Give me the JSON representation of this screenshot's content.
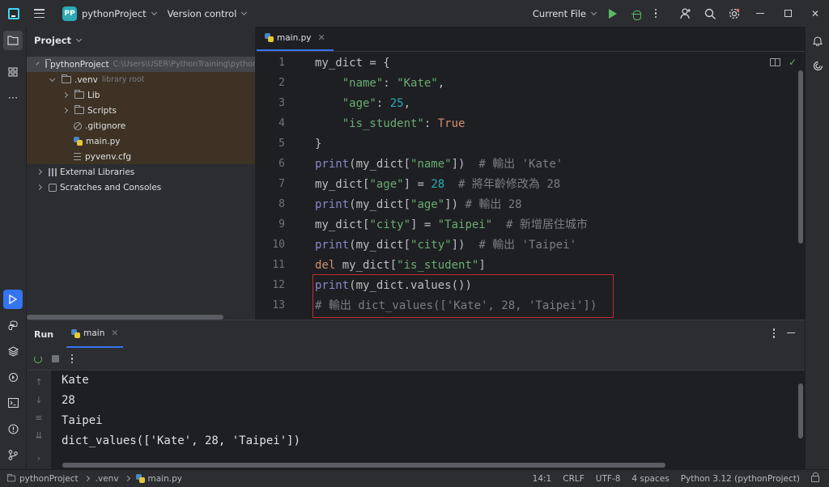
{
  "titlebar": {
    "project_badge": "PP",
    "project_name": "pythonProject",
    "version_control": "Version control",
    "run_config": "Current File"
  },
  "project_panel": {
    "title": "Project",
    "tree": [
      {
        "label": "pythonProject",
        "hint": "C:\\Users\\USER\\PythonTraining\\pythonProject",
        "type": "folder",
        "state": "expanded"
      },
      {
        "label": ".venv",
        "hint": "library root",
        "type": "folder",
        "state": "expanded"
      },
      {
        "label": "Lib",
        "type": "folder",
        "state": "collapsed"
      },
      {
        "label": "Scripts",
        "type": "folder",
        "state": "collapsed"
      },
      {
        "label": ".gitignore",
        "type": "ignore-file"
      },
      {
        "label": "main.py",
        "type": "python-file"
      },
      {
        "label": "pyvenv.cfg",
        "type": "config-file"
      },
      {
        "label": "External Libraries",
        "type": "library",
        "state": "collapsed"
      },
      {
        "label": "Scratches and Consoles",
        "type": "scratches",
        "state": "collapsed"
      }
    ]
  },
  "editor": {
    "tab": "main.py",
    "line_numbers": [
      "1",
      "2",
      "3",
      "4",
      "5",
      "6",
      "7",
      "8",
      "9",
      "10",
      "11",
      "12",
      "13"
    ],
    "lines": [
      [
        [
          "idt",
          "my_dict = {"
        ]
      ],
      [
        [
          "idt",
          "    "
        ],
        [
          "str",
          "\"name\""
        ],
        [
          "idt",
          ": "
        ],
        [
          "str",
          "\"Kate\""
        ],
        [
          "idt",
          ","
        ]
      ],
      [
        [
          "idt",
          "    "
        ],
        [
          "str",
          "\"age\""
        ],
        [
          "idt",
          ": "
        ],
        [
          "num",
          "25"
        ],
        [
          "idt",
          ","
        ]
      ],
      [
        [
          "idt",
          "    "
        ],
        [
          "str",
          "\"is_student\""
        ],
        [
          "idt",
          ": "
        ],
        [
          "kw",
          "True"
        ]
      ],
      [
        [
          "idt",
          "}"
        ]
      ],
      [
        [
          "fn",
          "print"
        ],
        [
          "idt",
          "(my_dict["
        ],
        [
          "str",
          "\"name\""
        ],
        [
          "idt",
          "])  "
        ],
        [
          "cm",
          "# 輸出 'Kate'"
        ]
      ],
      [
        [
          "idt",
          "my_dict["
        ],
        [
          "str",
          "\"age\""
        ],
        [
          "idt",
          "] = "
        ],
        [
          "num",
          "28"
        ],
        [
          "idt",
          "  "
        ],
        [
          "cm",
          "# 將年齡修改為 28"
        ]
      ],
      [
        [
          "fn",
          "print"
        ],
        [
          "idt",
          "(my_dict["
        ],
        [
          "str",
          "\"age\""
        ],
        [
          "idt",
          "]) "
        ],
        [
          "cm",
          "# 輸出 28"
        ]
      ],
      [
        [
          "idt",
          "my_dict["
        ],
        [
          "str",
          "\"city\""
        ],
        [
          "idt",
          "] = "
        ],
        [
          "str",
          "\"Taipei\""
        ],
        [
          "idt",
          "  "
        ],
        [
          "cm",
          "# 新增居住城市"
        ]
      ],
      [
        [
          "fn",
          "print"
        ],
        [
          "idt",
          "(my_dict["
        ],
        [
          "str",
          "\"city\""
        ],
        [
          "idt",
          "])  "
        ],
        [
          "cm",
          "# 輸出 'Taipei'"
        ]
      ],
      [
        [
          "kw",
          "del"
        ],
        [
          "idt",
          " my_dict["
        ],
        [
          "str",
          "\"is_student\""
        ],
        [
          "idt",
          "]"
        ]
      ],
      [
        [
          "fn",
          "print"
        ],
        [
          "idt",
          "(my_dict.values())"
        ]
      ],
      [
        [
          "cm",
          "# 輸出 dict_values(['Kate', 28, 'Taipei'])"
        ]
      ]
    ]
  },
  "run_panel": {
    "title": "Run",
    "tab": "main",
    "output": [
      "Kate",
      "28",
      "Taipei",
      "dict_values(['Kate', 28, 'Taipei'])"
    ]
  },
  "statusbar": {
    "crumbs": [
      "pythonProject",
      ".venv",
      "main.py"
    ],
    "position": "14:1",
    "line_separator": "CRLF",
    "encoding": "UTF-8",
    "indent": "4 spaces",
    "interpreter": "Python 3.12 (pythonProject)"
  },
  "colors": {
    "accent": "#3574f0",
    "run_green": "#5fb865",
    "highlight_box": "#c42b32",
    "panel_bg": "#2b2d30",
    "editor_bg": "#1e1f22"
  }
}
